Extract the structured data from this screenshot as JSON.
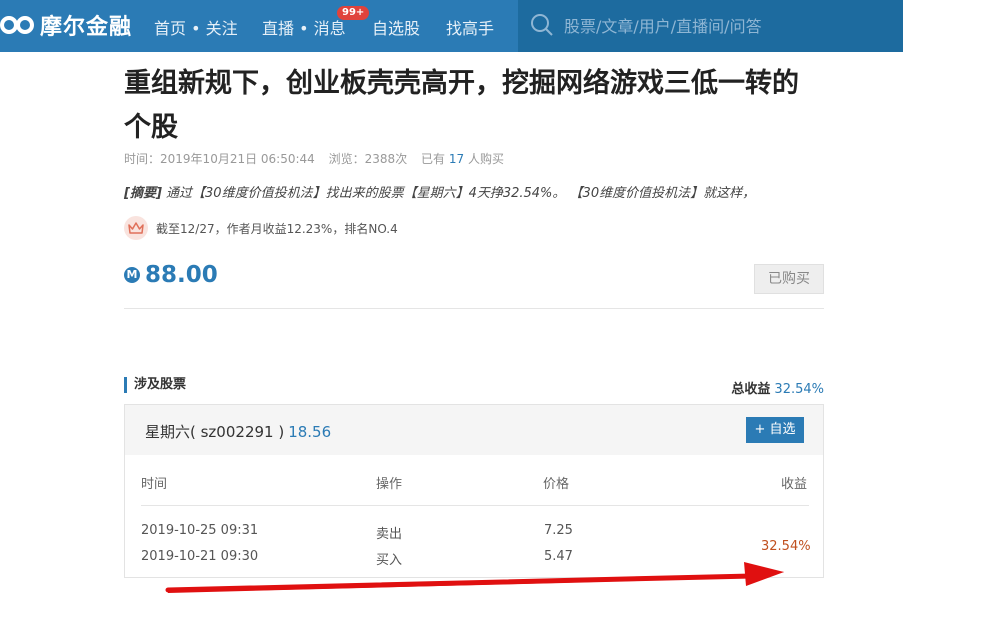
{
  "nav": {
    "logo_text": "摩尔金融",
    "items": [
      {
        "label": "首页 • 关注"
      },
      {
        "label": "直播 • 消息"
      },
      {
        "label": "自选股"
      },
      {
        "label": "找高手"
      }
    ],
    "badge": "99+",
    "search_placeholder": "股票/文章/用户/直播间/问答"
  },
  "article": {
    "title": "重组新规下，创业板壳壳高开，挖掘网络游戏三低一转的个股",
    "meta": {
      "time_label": "时间：",
      "time": "2019年10月21日 06:50:44",
      "views_label": "浏览：",
      "views": "2388次",
      "buyers_prefix": "已有",
      "buyers_count": "17",
      "buyers_suffix": "人购买"
    },
    "summary_label": "[摘要]",
    "summary_text": "通过【30维度价值投机法】找出来的股票【星期六】4天挣32.54%。 【30维度价值投机法】就这样，",
    "rank_text": "截至12/27，作者月收益12.23%，排名NO.4",
    "price_symbol": "M",
    "price": "88.00",
    "bought_label": "已购买"
  },
  "stocks": {
    "section_title": "涉及股票",
    "total_label": "总收益",
    "total_value": "32.54%",
    "stock_name": "星期六( sz002291 )",
    "stock_price": "18.56",
    "add_label": "+ 自选",
    "columns": [
      "时间",
      "操作",
      "价格",
      "收益"
    ],
    "rows": [
      {
        "time": "2019-10-25 09:31",
        "op": "卖出",
        "price": "7.25"
      },
      {
        "time": "2019-10-21 09:30",
        "op": "买入",
        "price": "5.47"
      }
    ],
    "profit": "32.54%"
  },
  "colors": {
    "nav_bg": "#2b7bb5",
    "accent": "#2b7bb5",
    "profit": "#c0501f",
    "arrow": "#e01010"
  }
}
